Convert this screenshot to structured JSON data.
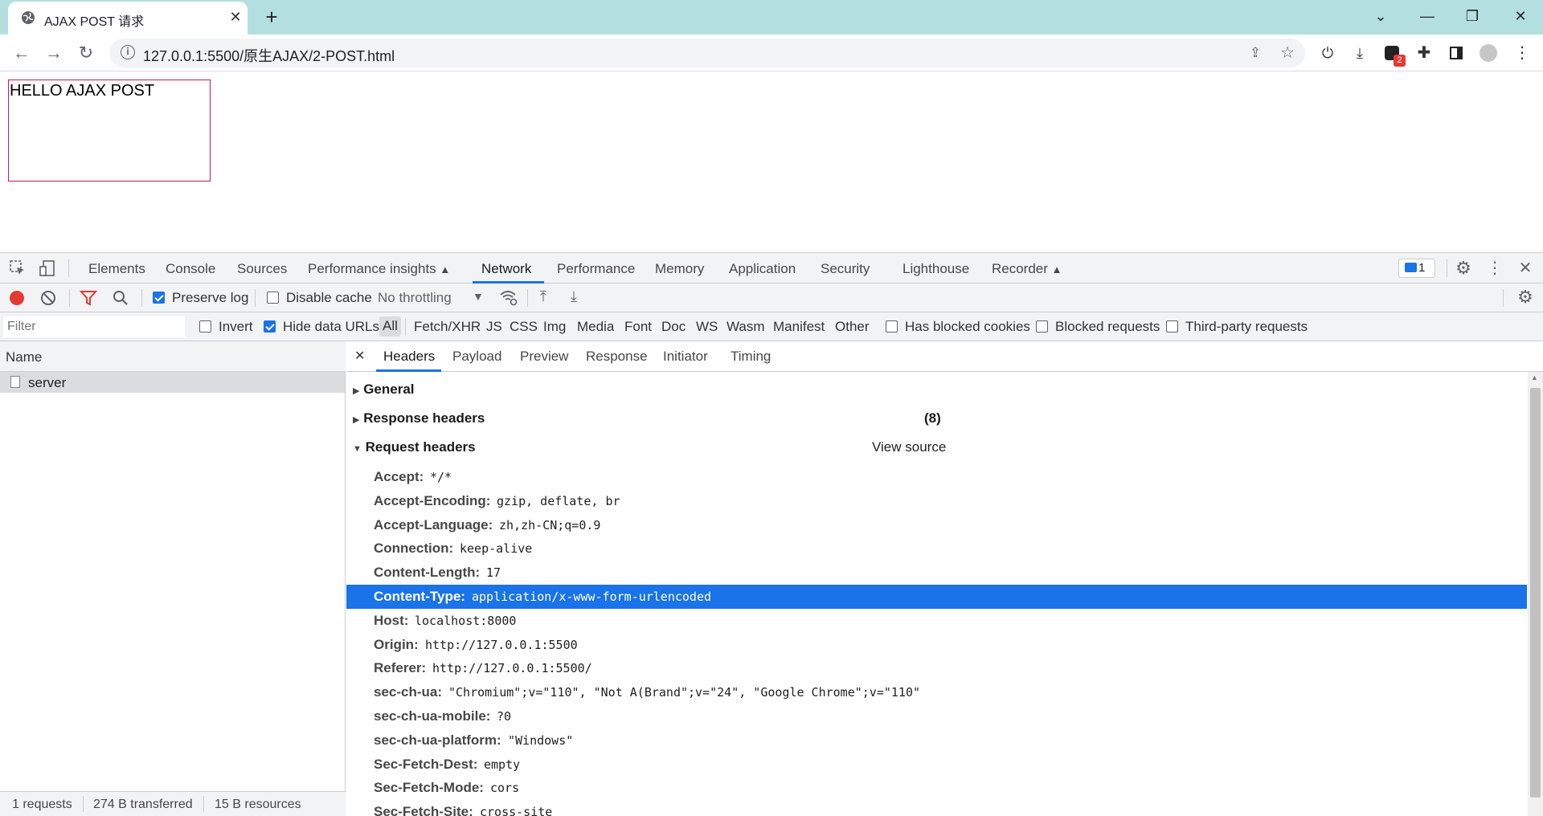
{
  "browser": {
    "tab_title": "AJAX POST 请求",
    "url": "127.0.0.1:5500/原生AJAX/2-POST.html",
    "extension_badge": "2"
  },
  "page": {
    "box_text": "HELLO AJAX POST"
  },
  "devtools": {
    "tabs": [
      "Elements",
      "Console",
      "Sources",
      "Performance insights",
      "Network",
      "Performance",
      "Memory",
      "Application",
      "Security",
      "Lighthouse",
      "Recorder"
    ],
    "active_tab": "Network",
    "issues_count": "1",
    "network_toolbar": {
      "preserve_log": "Preserve log",
      "disable_cache": "Disable cache",
      "throttling": "No throttling"
    },
    "filter_bar": {
      "filter_placeholder": "Filter",
      "invert": "Invert",
      "hide_data_urls": "Hide data URLs",
      "types": [
        "All",
        "Fetch/XHR",
        "JS",
        "CSS",
        "Img",
        "Media",
        "Font",
        "Doc",
        "WS",
        "Wasm",
        "Manifest",
        "Other"
      ],
      "has_blocked_cookies": "Has blocked cookies",
      "blocked_requests": "Blocked requests",
      "third_party": "Third-party requests"
    },
    "request_list": {
      "header": "Name",
      "rows": [
        "server"
      ]
    },
    "summary": {
      "requests": "1 requests",
      "transferred": "274 B transferred",
      "resources": "15 B resources"
    },
    "detail_tabs": [
      "Headers",
      "Payload",
      "Preview",
      "Response",
      "Initiator",
      "Timing"
    ],
    "sections": {
      "general": "General",
      "response_headers": "Response headers",
      "response_count": "(8)",
      "request_headers": "Request headers",
      "view_source": "View source"
    },
    "request_headers": [
      {
        "key": "Accept:",
        "value": "*/*"
      },
      {
        "key": "Accept-Encoding:",
        "value": "gzip, deflate, br"
      },
      {
        "key": "Accept-Language:",
        "value": "zh,zh-CN;q=0.9"
      },
      {
        "key": "Connection:",
        "value": "keep-alive"
      },
      {
        "key": "Content-Length:",
        "value": "17"
      },
      {
        "key": "Content-Type:",
        "value": "application/x-www-form-urlencoded"
      },
      {
        "key": "Host:",
        "value": "localhost:8000"
      },
      {
        "key": "Origin:",
        "value": "http://127.0.0.1:5500"
      },
      {
        "key": "Referer:",
        "value": "http://127.0.0.1:5500/"
      },
      {
        "key": "sec-ch-ua:",
        "value": "\"Chromium\";v=\"110\", \"Not A(Brand\";v=\"24\", \"Google Chrome\";v=\"110\""
      },
      {
        "key": "sec-ch-ua-mobile:",
        "value": "?0"
      },
      {
        "key": "sec-ch-ua-platform:",
        "value": "\"Windows\""
      },
      {
        "key": "Sec-Fetch-Dest:",
        "value": "empty"
      },
      {
        "key": "Sec-Fetch-Mode:",
        "value": "cors"
      },
      {
        "key": "Sec-Fetch-Site:",
        "value": "cross-site"
      }
    ],
    "selected_header": "Content-Type:"
  },
  "colors": {
    "tabstrip": "#b4dfe0",
    "accent": "#1a73e8",
    "record": "#e53935",
    "box_border": "#c2185b"
  }
}
